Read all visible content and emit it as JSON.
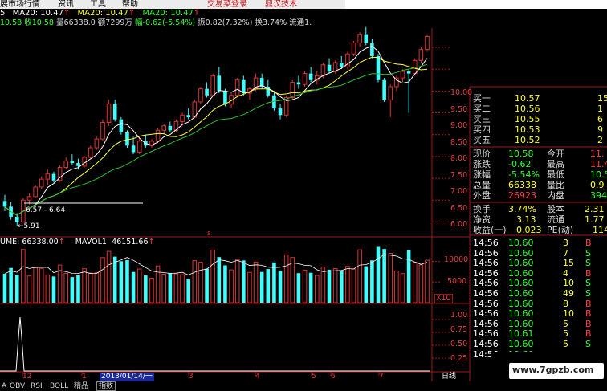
{
  "menu": {
    "items": [
      "展市场行情",
      "资讯",
      "工具",
      "帮助"
    ],
    "highlight": [
      "交易菜登录",
      "鼎汉技术"
    ]
  },
  "ma_line": {
    "prefix": "5",
    "ma5_label": "MA20: 10.47",
    "ma5_arrow": "↑",
    "ma10_label": "MA20: 10.47",
    "ma20_label": "MA20: 10.47"
  },
  "info_line": {
    "prefix": "10.58",
    "close": "收10.58",
    "volume": "量66338.0",
    "amount": "额7299万",
    "change": "幅-0.62(-5.54%)",
    "amplitude": "振0.82(7.32%)",
    "turnover": "换3.74%",
    "circulation": "流通1."
  },
  "price_axis": [
    "10.00",
    "9.50",
    "9.00",
    "8.50",
    "8.00",
    "7.50",
    "7.00",
    "6.50",
    "6.00"
  ],
  "annotations": {
    "range_label": "6.57 - 6.64",
    "low_label": "5.91"
  },
  "volume_header": {
    "vol": "UME: 66338.00",
    "vol_arrow": "↑",
    "mavol": "MAVOL1: 46151.66",
    "mavol_arrow": "↑"
  },
  "volume_axis": [
    "10000",
    "5000"
  ],
  "volume_unit": "X10",
  "indicator_axis": [
    "1.00",
    "0.75",
    "0.50",
    "0.25"
  ],
  "date_axis": {
    "labels": [
      "12",
      "1",
      "2013/01/14/一",
      "3",
      "4",
      "5",
      "6",
      "7"
    ],
    "period": "日线"
  },
  "bottom_tabs": [
    "A",
    "OBV",
    "RSI",
    "BOLL",
    "精品",
    "指数"
  ],
  "quote": {
    "asks": [
      {
        "label": "买一",
        "price": "10.57",
        "vol": "15"
      },
      {
        "label": "买二",
        "price": "10.56",
        "vol": "1"
      },
      {
        "label": "买三",
        "price": "10.55",
        "vol": "6"
      },
      {
        "label": "买四",
        "price": "10.53",
        "vol": "9"
      },
      {
        "label": "买五",
        "price": "10.52",
        "vol": "2"
      }
    ],
    "stats": [
      {
        "l1": "现价",
        "v1": "10.58",
        "l2": "今开",
        "v2": "11."
      },
      {
        "l1": "涨跌",
        "v1": "-0.62",
        "l2": "最高",
        "v2": "11.4"
      },
      {
        "l1": "涨幅",
        "v1": "-5.54%",
        "l2": "最低",
        "v2": "10.5"
      },
      {
        "l1": "总量",
        "v1": "66338",
        "l2": "量比",
        "v2": "0.9"
      },
      {
        "l1": "外盘",
        "v1": "26923",
        "l2": "内盘",
        "v2": "3941"
      }
    ],
    "stats2": [
      {
        "l1": "换手",
        "v1": "3.74%",
        "l2": "股本",
        "v2": "2.31"
      },
      {
        "l1": "净资",
        "v1": "3.13",
        "l2": "流通",
        "v2": "1.77"
      },
      {
        "l1": "收益(一)",
        "v1": "0.023",
        "l2": "PE(动)",
        "v2": "114"
      }
    ]
  },
  "ticks": [
    {
      "time": "14:56",
      "price": "10.60",
      "vol": "3",
      "side": "B"
    },
    {
      "time": "14:56",
      "price": "10.60",
      "vol": "7",
      "side": "S"
    },
    {
      "time": "14:56",
      "price": "10.60",
      "vol": "15",
      "side": "S"
    },
    {
      "time": "14:56",
      "price": "10.60",
      "vol": "4",
      "side": "B"
    },
    {
      "time": "14:56",
      "price": "10.60",
      "vol": "10",
      "side": "S"
    },
    {
      "time": "14:56",
      "price": "10.60",
      "vol": "49",
      "side": "S"
    },
    {
      "time": "14:56",
      "price": "10.60",
      "vol": "8",
      "side": "B"
    },
    {
      "time": "14:56",
      "price": "10.60",
      "vol": "10",
      "side": "B"
    },
    {
      "time": "14:56",
      "price": "10.60",
      "vol": "5",
      "side": "B"
    },
    {
      "time": "14:56",
      "price": "10.61",
      "vol": "5",
      "side": "B"
    },
    {
      "time": "14:56",
      "price": "10.60",
      "vol": "5",
      "side": "S"
    },
    {
      "time": "14:56",
      "price": "10.60",
      "vol": "",
      "side": ""
    }
  ],
  "watermark": "www.7gpzb.com",
  "colors": {
    "up": "#e03030",
    "down": "#40ffff",
    "ma_white": "#ffffff",
    "ma_yellow": "#ffff40",
    "ma_green": "#30c030",
    "axis_red": "#a01818"
  },
  "chart_data": {
    "type": "candlestick",
    "price_ylim": [
      5.75,
      10.35
    ],
    "high_marker": 10.47,
    "low_marker": 5.91,
    "candles": [
      {
        "o": 6.48,
        "h": 6.62,
        "l": 6.25,
        "c": 6.35
      },
      {
        "o": 6.35,
        "h": 6.45,
        "l": 6.05,
        "c": 6.12
      },
      {
        "o": 6.12,
        "h": 6.2,
        "l": 5.91,
        "c": 6.0
      },
      {
        "o": 6.0,
        "h": 6.55,
        "l": 5.98,
        "c": 6.5
      },
      {
        "o": 6.5,
        "h": 6.65,
        "l": 6.4,
        "c": 6.58
      },
      {
        "o": 6.58,
        "h": 6.85,
        "l": 6.55,
        "c": 6.8
      },
      {
        "o": 6.8,
        "h": 7.05,
        "l": 6.75,
        "c": 6.98
      },
      {
        "o": 6.98,
        "h": 7.2,
        "l": 6.85,
        "c": 7.1
      },
      {
        "o": 7.1,
        "h": 7.15,
        "l": 6.9,
        "c": 6.95
      },
      {
        "o": 6.95,
        "h": 7.3,
        "l": 6.92,
        "c": 7.25
      },
      {
        "o": 7.25,
        "h": 7.48,
        "l": 7.2,
        "c": 7.4
      },
      {
        "o": 7.4,
        "h": 7.55,
        "l": 7.3,
        "c": 7.35
      },
      {
        "o": 7.35,
        "h": 7.45,
        "l": 7.2,
        "c": 7.28
      },
      {
        "o": 7.28,
        "h": 7.52,
        "l": 7.25,
        "c": 7.48
      },
      {
        "o": 7.48,
        "h": 7.75,
        "l": 7.45,
        "c": 7.7
      },
      {
        "o": 7.7,
        "h": 7.95,
        "l": 7.65,
        "c": 7.9
      },
      {
        "o": 7.9,
        "h": 8.35,
        "l": 7.85,
        "c": 8.28
      },
      {
        "o": 8.28,
        "h": 8.8,
        "l": 8.2,
        "c": 8.7
      },
      {
        "o": 8.7,
        "h": 8.8,
        "l": 8.3,
        "c": 8.35
      },
      {
        "o": 8.35,
        "h": 8.4,
        "l": 8.0,
        "c": 8.05
      },
      {
        "o": 8.05,
        "h": 8.1,
        "l": 7.7,
        "c": 7.75
      },
      {
        "o": 7.75,
        "h": 7.95,
        "l": 7.55,
        "c": 7.6
      },
      {
        "o": 7.6,
        "h": 7.9,
        "l": 7.55,
        "c": 7.85
      },
      {
        "o": 7.85,
        "h": 8.0,
        "l": 7.7,
        "c": 7.75
      },
      {
        "o": 7.75,
        "h": 7.9,
        "l": 7.7,
        "c": 7.85
      },
      {
        "o": 7.85,
        "h": 8.15,
        "l": 7.8,
        "c": 8.1
      },
      {
        "o": 8.1,
        "h": 8.25,
        "l": 8.0,
        "c": 8.2
      },
      {
        "o": 8.2,
        "h": 8.3,
        "l": 8.05,
        "c": 8.1
      },
      {
        "o": 8.1,
        "h": 8.35,
        "l": 8.05,
        "c": 8.3
      },
      {
        "o": 8.3,
        "h": 8.5,
        "l": 8.2,
        "c": 8.45
      },
      {
        "o": 8.45,
        "h": 8.6,
        "l": 8.35,
        "c": 8.4
      },
      {
        "o": 8.4,
        "h": 8.8,
        "l": 8.38,
        "c": 8.75
      },
      {
        "o": 8.75,
        "h": 9.1,
        "l": 8.7,
        "c": 9.05
      },
      {
        "o": 9.05,
        "h": 9.2,
        "l": 8.85,
        "c": 8.9
      },
      {
        "o": 8.9,
        "h": 9.4,
        "l": 8.88,
        "c": 9.35
      },
      {
        "o": 9.35,
        "h": 9.55,
        "l": 8.95,
        "c": 9.0
      },
      {
        "o": 9.0,
        "h": 9.05,
        "l": 8.65,
        "c": 8.7
      },
      {
        "o": 8.7,
        "h": 8.95,
        "l": 8.6,
        "c": 8.9
      },
      {
        "o": 8.9,
        "h": 9.3,
        "l": 8.85,
        "c": 9.25
      },
      {
        "o": 9.25,
        "h": 9.35,
        "l": 8.9,
        "c": 8.95
      },
      {
        "o": 8.95,
        "h": 9.1,
        "l": 8.8,
        "c": 9.05
      },
      {
        "o": 9.05,
        "h": 9.4,
        "l": 9.0,
        "c": 9.3
      },
      {
        "o": 9.3,
        "h": 9.4,
        "l": 9.05,
        "c": 9.1
      },
      {
        "o": 9.1,
        "h": 9.25,
        "l": 8.85,
        "c": 8.9
      },
      {
        "o": 8.9,
        "h": 9.0,
        "l": 8.55,
        "c": 8.6
      },
      {
        "o": 8.6,
        "h": 8.7,
        "l": 8.35,
        "c": 8.45
      },
      {
        "o": 8.45,
        "h": 8.9,
        "l": 8.4,
        "c": 8.85
      },
      {
        "o": 8.85,
        "h": 9.25,
        "l": 8.8,
        "c": 9.2
      },
      {
        "o": 9.2,
        "h": 9.35,
        "l": 9.05,
        "c": 9.15
      },
      {
        "o": 9.15,
        "h": 9.45,
        "l": 9.1,
        "c": 9.4
      },
      {
        "o": 9.4,
        "h": 9.55,
        "l": 9.2,
        "c": 9.25
      },
      {
        "o": 9.25,
        "h": 9.45,
        "l": 9.15,
        "c": 9.35
      },
      {
        "o": 9.35,
        "h": 9.65,
        "l": 9.3,
        "c": 9.6
      },
      {
        "o": 9.6,
        "h": 9.75,
        "l": 9.4,
        "c": 9.45
      },
      {
        "o": 9.45,
        "h": 9.7,
        "l": 9.4,
        "c": 9.65
      },
      {
        "o": 9.65,
        "h": 9.8,
        "l": 9.5,
        "c": 9.55
      },
      {
        "o": 9.55,
        "h": 9.9,
        "l": 9.5,
        "c": 9.85
      },
      {
        "o": 9.85,
        "h": 10.15,
        "l": 9.8,
        "c": 10.1
      },
      {
        "o": 10.1,
        "h": 10.35,
        "l": 10.0,
        "c": 10.3
      },
      {
        "o": 10.3,
        "h": 10.47,
        "l": 10.05,
        "c": 10.1
      },
      {
        "o": 10.1,
        "h": 10.2,
        "l": 9.75,
        "c": 9.8
      },
      {
        "o": 9.8,
        "h": 9.85,
        "l": 9.2,
        "c": 9.25
      },
      {
        "o": 9.25,
        "h": 9.3,
        "l": 8.75,
        "c": 8.8
      },
      {
        "o": 8.8,
        "h": 9.15,
        "l": 8.4,
        "c": 9.1
      },
      {
        "o": 9.1,
        "h": 9.35,
        "l": 9.0,
        "c": 9.3
      },
      {
        "o": 9.3,
        "h": 9.5,
        "l": 9.2,
        "c": 9.45
      },
      {
        "o": 9.45,
        "h": 9.5,
        "l": 8.5,
        "c": 9.4
      },
      {
        "o": 9.4,
        "h": 9.75,
        "l": 9.35,
        "c": 9.7
      },
      {
        "o": 9.7,
        "h": 10.0,
        "l": 9.65,
        "c": 9.95
      },
      {
        "o": 9.95,
        "h": 10.3,
        "l": 9.9,
        "c": 10.25
      }
    ],
    "volume_ylim": [
      0,
      14000
    ],
    "indicator_ylim": [
      0,
      1.2
    ]
  }
}
